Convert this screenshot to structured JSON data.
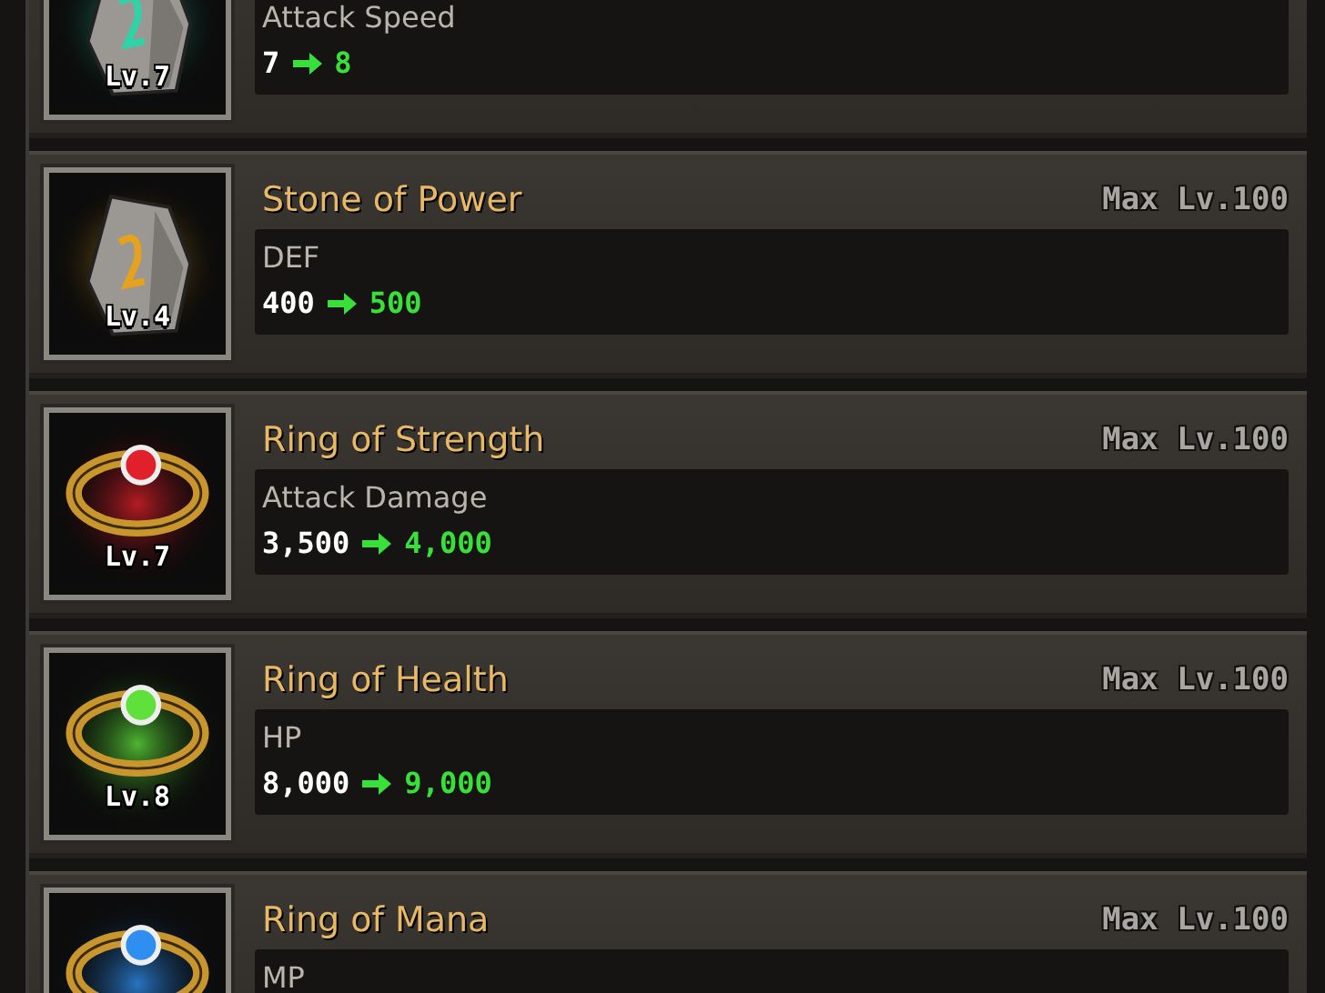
{
  "items": [
    {
      "kind": "stone",
      "color": "#2fd3a8",
      "level": "Lv.7",
      "stat": "Attack Speed",
      "from": "7",
      "to": "8"
    },
    {
      "kind": "stone",
      "color": "#e6a21c",
      "name": "Stone of Power",
      "max_level": "Max Lv.100",
      "level": "Lv.4",
      "stat": "DEF",
      "from": "400",
      "to": "500"
    },
    {
      "kind": "ring",
      "color": "#e0202a",
      "name": "Ring of Strength",
      "max_level": "Max Lv.100",
      "level": "Lv.7",
      "stat": "Attack Damage",
      "from": "3,500",
      "to": "4,000"
    },
    {
      "kind": "ring",
      "color": "#5fe03a",
      "name": "Ring of Health",
      "max_level": "Max Lv.100",
      "level": "Lv.8",
      "stat": "HP",
      "from": "8,000",
      "to": "9,000"
    },
    {
      "kind": "ring",
      "color": "#2f8ff0",
      "name": "Ring of Mana",
      "max_level": "Max Lv.100",
      "stat": "MP"
    }
  ]
}
